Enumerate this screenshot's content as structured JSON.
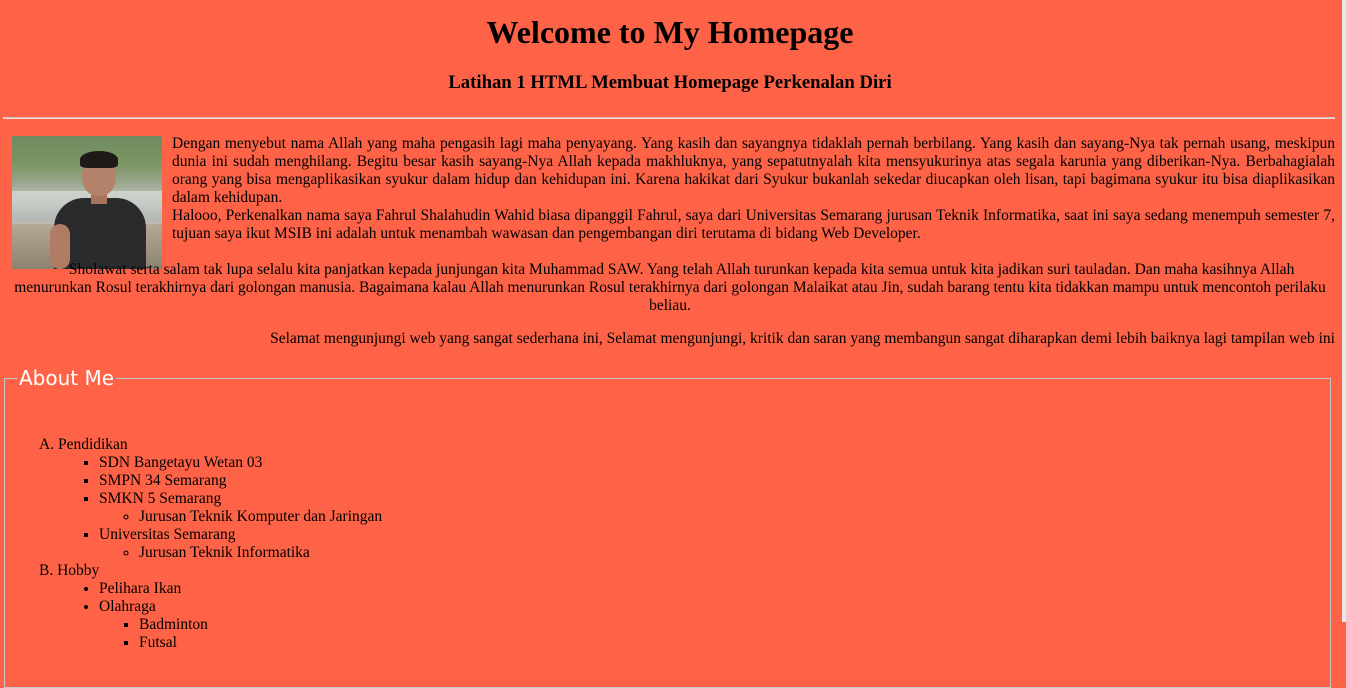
{
  "header": {
    "title": "Welcome to My Homepage",
    "subtitle": "Latihan 1 HTML Membuat Homepage Perkenalan Diri"
  },
  "intro": {
    "paragraph_1": "Dengan menyebut nama Allah yang maha pengasih lagi maha penyayang. Yang kasih dan sayangnya tidaklah pernah berbilang. Yang kasih dan sayang-Nya tak pernah usang, meskipun dunia ini sudah menghilang. Begitu besar kasih sayang-Nya Allah kepada makhluknya, yang sepatutnyalah kita mensyukurinya atas segala karunia yang diberikan-Nya. Berbahagialah orang yang bisa mengaplikasikan syukur dalam hidup dan kehidupan ini. Karena hakikat dari Syukur bukanlah sekedar diucapkan oleh lisan, tapi bagimana syukur itu bisa diaplikasikan dalam kehidupan.",
    "paragraph_2": "Halooo, Perkenalkan nama saya Fahrul Shalahudin Wahid biasa dipanggil Fahrul, saya dari Universitas Semarang jurusan Teknik Informatika, saat ini saya sedang menempuh semester 7, tujuan saya ikut MSIB ini adalah untuk menambah wawasan dan pengembangan diri terutama di bidang Web Developer."
  },
  "center_paragraph": "Sholawat serta salam tak lupa selalu kita panjatkan kepada junjungan kita Muhammad SAW. Yang telah Allah turunkan kepada kita semua untuk kita jadikan suri tauladan. Dan maha kasihnya Allah menurunkan Rosul terakhirnya dari golongan manusia. Bagaimana kalau Allah menurunkan Rosul terakhirnya dari golongan Malaikat atau Jin, sudah barang tentu kita tidakkan mampu untuk mencontoh perilaku beliau.",
  "closing_paragraph": "Selamat mengunjungi web yang sangat sederhana ini, Selamat mengunjungi, kritik dan saran yang membangun sangat diharapkan demi lebih baiknya lagi tampilan web ini",
  "about": {
    "legend": "About Me",
    "education": {
      "label": "A. Pendidikan",
      "items": [
        {
          "name": "SDN Bangetayu Wetan 03"
        },
        {
          "name": "SMPN 34 Semarang"
        },
        {
          "name": "SMKN 5 Semarang",
          "major": "Jurusan Teknik Komputer dan Jaringan"
        },
        {
          "name": "Universitas Semarang",
          "major": "Jurusan Teknik Informatika"
        }
      ]
    },
    "hobby": {
      "label": "B. Hobby",
      "items": [
        "Pelihara Ikan",
        "Olahraga"
      ],
      "sports": [
        "Badminton",
        "Futsal"
      ]
    }
  },
  "colors": {
    "background": "#ff6347",
    "legend_text": "#ffffff"
  }
}
